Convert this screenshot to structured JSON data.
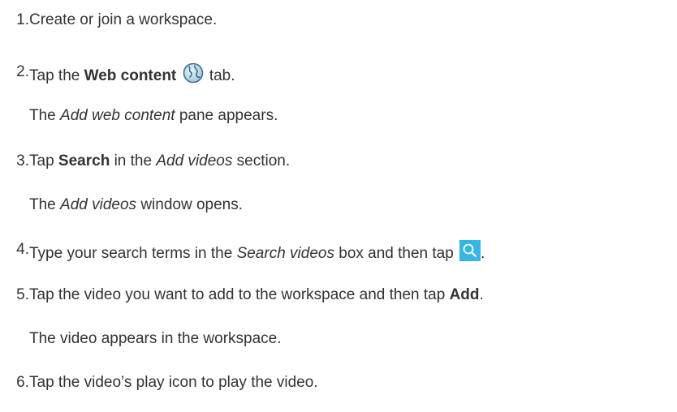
{
  "steps": [
    {
      "number": "1.",
      "text": "Create or join a workspace."
    },
    {
      "number": "2.",
      "pre": "Tap the ",
      "bold": "Web content",
      "post": " tab.",
      "note_pre": "The ",
      "note_italic": "Add web content",
      "note_post": " pane appears."
    },
    {
      "number": "3.",
      "pre": "Tap ",
      "bold": "Search",
      "mid": " in the ",
      "italic": "Add videos",
      "post": " section.",
      "note_pre": "The ",
      "note_italic": "Add videos",
      "note_post": " window opens."
    },
    {
      "number": "4.",
      "pre": "Type your search terms in the ",
      "italic": "Search videos",
      "post": " box and then tap ",
      "end": "."
    },
    {
      "number": "5.",
      "pre": "Tap the video you want to add to the workspace and then tap ",
      "bold": "Add",
      "post": ".",
      "note": "The video appears in the workspace."
    },
    {
      "number": "6.",
      "text": "Tap the video’s play icon to play the video."
    }
  ],
  "icons": {
    "web_content": "globe-icon",
    "search": "magnifier-icon",
    "search_bg": "#34b6e6"
  }
}
